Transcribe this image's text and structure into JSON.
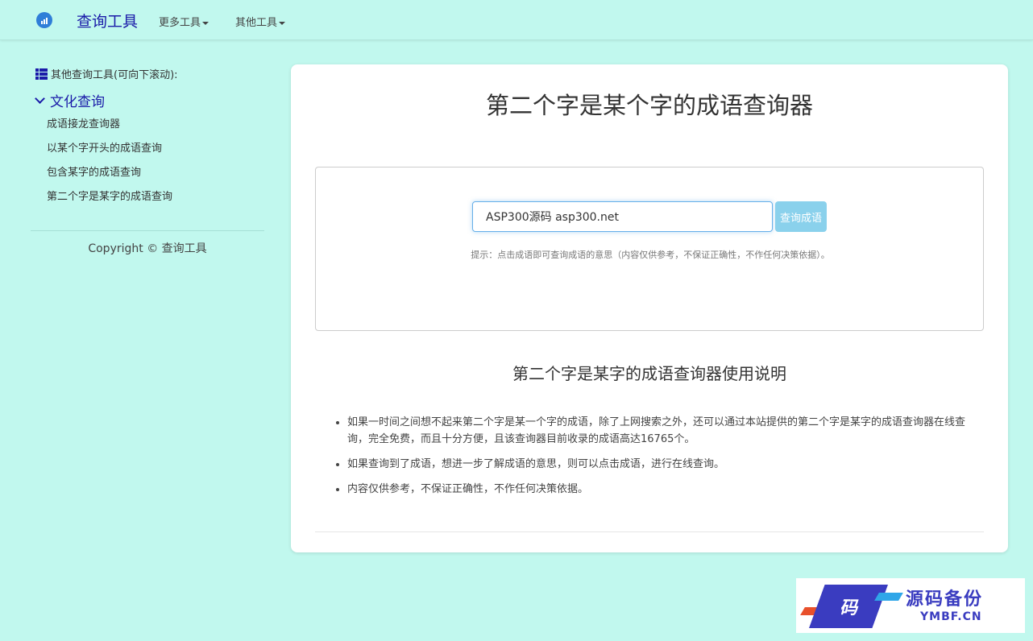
{
  "navbar": {
    "brand": "查询工具",
    "menus": [
      {
        "label": "更多工具"
      },
      {
        "label": "其他工具"
      }
    ]
  },
  "sidebar": {
    "header": "其他查询工具(可向下滚动):",
    "category": "文化查询",
    "items": [
      {
        "label": "成语接龙查询器"
      },
      {
        "label": "以某个字开头的成语查询"
      },
      {
        "label": "包含某字的成语查询"
      },
      {
        "label": "第二个字是某字的成语查询"
      }
    ],
    "copyright": "Copyright © 查询工具"
  },
  "main": {
    "title": "第二个字是某个字的成语查询器",
    "search": {
      "value": "ASP300源码 asp300.net",
      "button_label": "查询成语"
    },
    "hint": "提示：点击成语即可查询成语的意思（内容仅供参考，不保证正确性，不作任何决策依据）。",
    "subtitle": "第二个字是某字的成语查询器使用说明",
    "notes": [
      "如果一时间之间想不起来第二个字是某一个字的成语，除了上网搜索之外，还可以通过本站提供的第二个字是某字的成语查询器在线查询，完全免费，而且十分方便，且该查询器目前收录的成语高达16765个。",
      "如果查询到了成语，想进一步了解成语的意思，则可以点击成语，进行在线查询。",
      "内容仅供参考，不保证正确性，不作任何决策依据。"
    ]
  },
  "watermark": {
    "badge": "码",
    "title": "源码备份",
    "sub": "YMBF.CN"
  }
}
